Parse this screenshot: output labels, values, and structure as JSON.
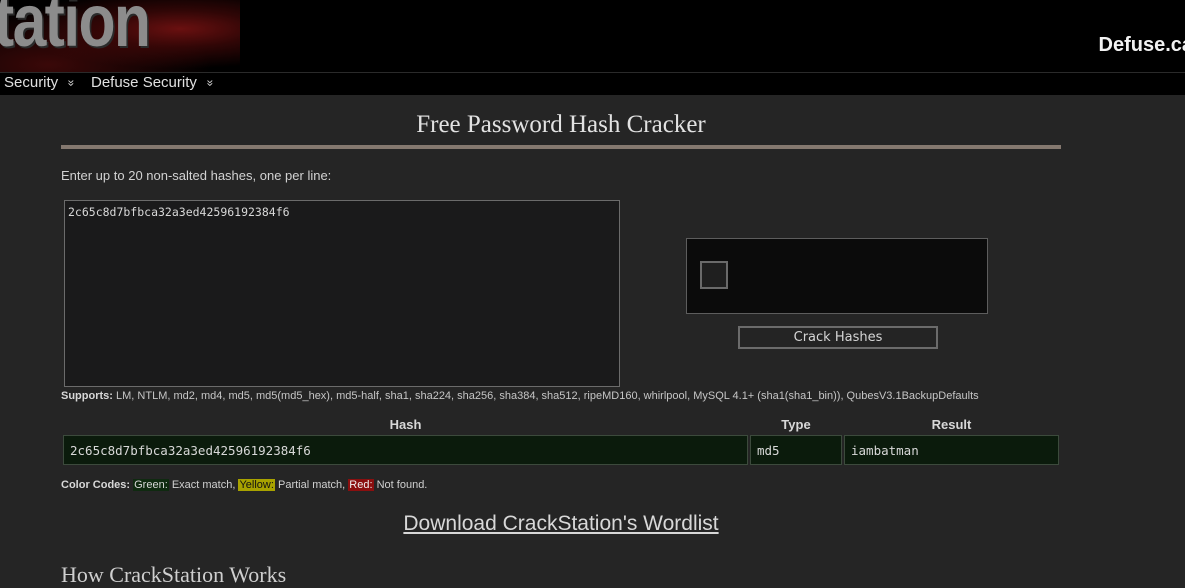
{
  "header": {
    "logo_text": "tation",
    "brand_text": "Defuse.ca",
    "nav": [
      {
        "label": "Security"
      },
      {
        "label": "Defuse Security"
      }
    ]
  },
  "page": {
    "title": "Free Password Hash Cracker",
    "instructions": "Enter up to 20 non-salted hashes, one per line:",
    "hash_input_value": "2c65c8d7bfbca32a3ed42596192384f6",
    "crack_button": "Crack Hashes",
    "supports_label": "Supports:",
    "supports_list": "LM, NTLM, md2, md4, md5, md5(md5_hex), md5-half, sha1, sha224, sha256, sha384, sha512, ripeMD160, whirlpool, MySQL 4.1+ (sha1(sha1_bin)), QubesV3.1BackupDefaults"
  },
  "results": {
    "columns": [
      "Hash",
      "Type",
      "Result"
    ],
    "rows": [
      {
        "hash": "2c65c8d7bfbca32a3ed42596192384f6",
        "type": "md5",
        "result": "iambatman"
      }
    ]
  },
  "color_codes": {
    "label": "Color Codes:",
    "green": "Green:",
    "green_text": "Exact match,",
    "yellow": "Yellow:",
    "yellow_text": "Partial match,",
    "red": "Red:",
    "red_text": "Not found."
  },
  "download_link": "Download CrackStation's Wordlist",
  "next_heading": "How CrackStation Works",
  "colors": {
    "background": "#252525",
    "header": "#000000",
    "rule": "#84786f",
    "match_green": "#0b1b0c"
  }
}
